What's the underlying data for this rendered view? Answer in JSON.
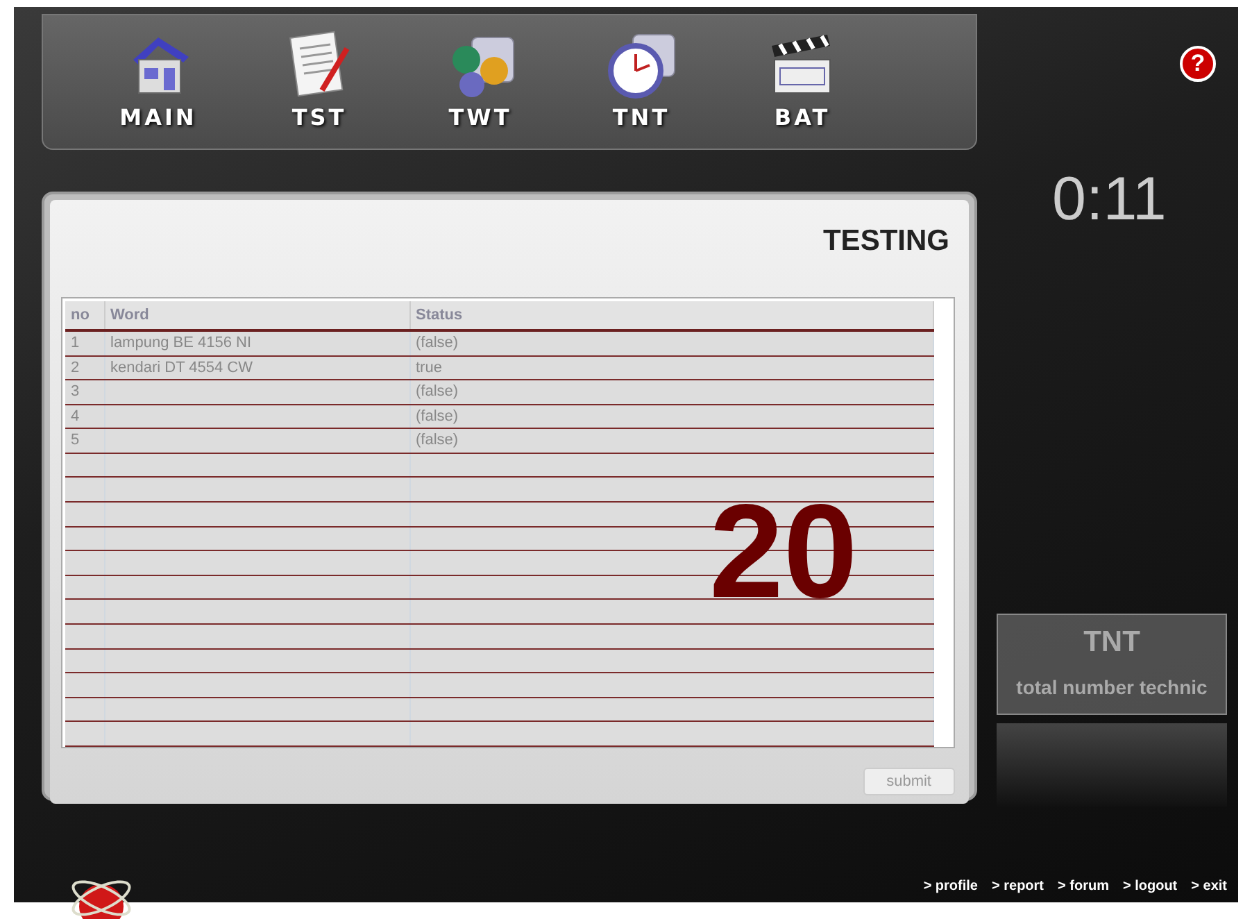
{
  "toolbar": [
    {
      "label": "MAIN",
      "kind": "house"
    },
    {
      "label": "TST",
      "kind": "document"
    },
    {
      "label": "TWT",
      "kind": "letters"
    },
    {
      "label": "TNT",
      "kind": "clock"
    },
    {
      "label": "BAT",
      "kind": "clapper"
    }
  ],
  "help": {
    "label": "?"
  },
  "panel": {
    "title": "TESTING"
  },
  "table": {
    "columns": [
      "no",
      "Word",
      "Status"
    ],
    "rows": [
      {
        "cells": [
          "1",
          "lampung BE 4156 NI",
          "(false)"
        ]
      },
      {
        "cells": [
          "2",
          "kendari DT 4554 CW",
          "true"
        ]
      },
      {
        "cells": [
          "3",
          "",
          "(false)"
        ]
      },
      {
        "cells": [
          "4",
          "",
          "(false)"
        ]
      },
      {
        "cells": [
          "5",
          "",
          "(false)"
        ]
      }
    ]
  },
  "big_number": "20",
  "submit": "submit",
  "timer": "0:11",
  "info_card": {
    "title": "TNT",
    "subtitle": "total number technic"
  },
  "footer_links": [
    "> profile",
    "> report",
    "> forum",
    "> logout",
    "> exit"
  ]
}
